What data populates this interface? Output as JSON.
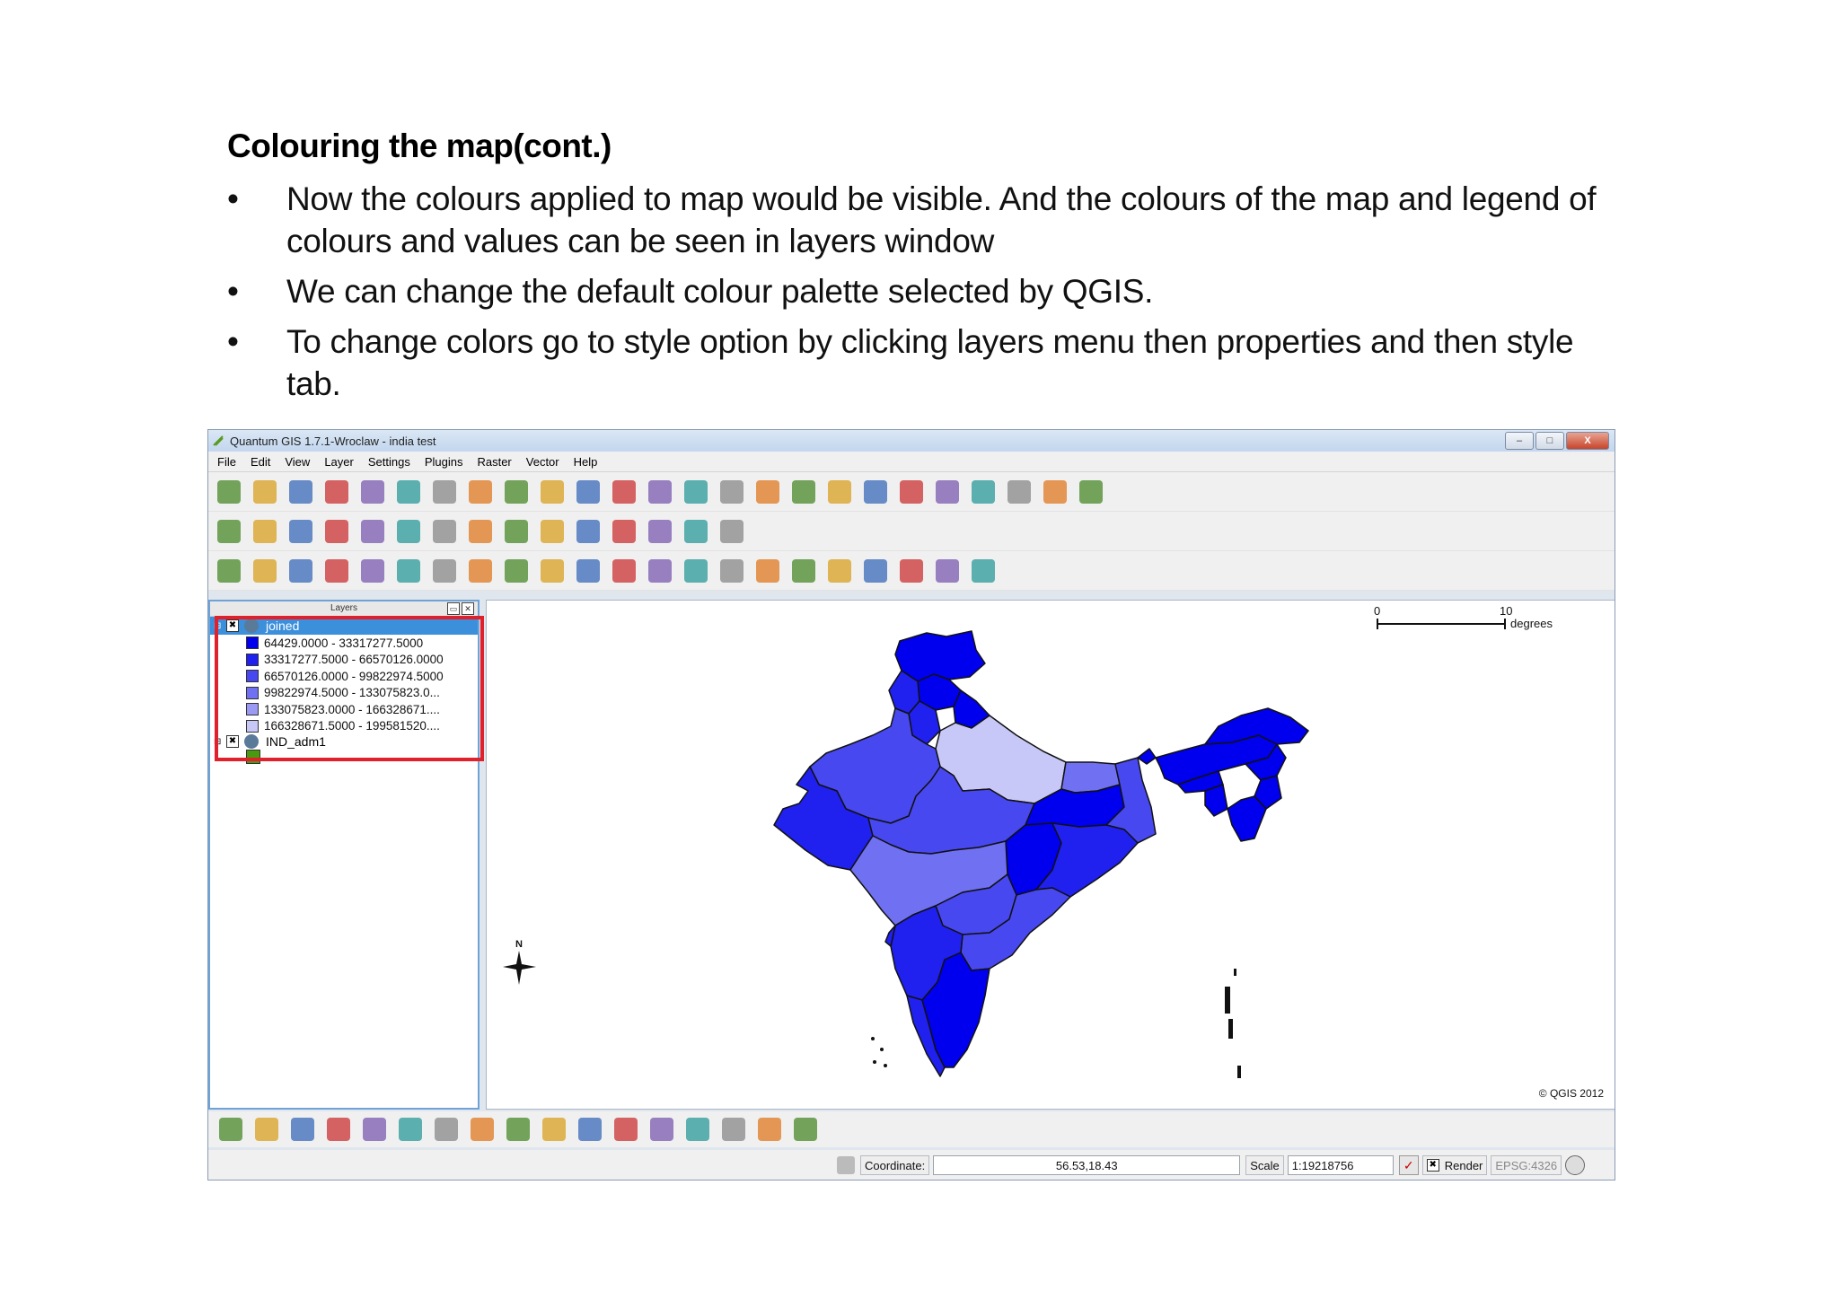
{
  "slide": {
    "title": "Colouring the map(cont.)",
    "bullets": [
      "Now the colours applied to map would be visible. And the colours of the map and legend of colours and values can be seen in layers window",
      "We can change the default colour palette selected by QGIS.",
      "To change colors go to style option by clicking layers menu then properties and then style tab."
    ],
    "bullet_symbol": "•"
  },
  "window": {
    "title": "Quantum GIS 1.7.1-Wroclaw - india test",
    "buttons": [
      "–",
      "□",
      "X"
    ]
  },
  "menu": [
    "File",
    "Edit",
    "View",
    "Layer",
    "Settings",
    "Plugins",
    "Raster",
    "Vector",
    "Help"
  ],
  "layers_panel": {
    "header": "Layers",
    "layers": [
      {
        "name": "joined",
        "checked": "✖",
        "legend": [
          {
            "label": "64429.0000 - 33317277.5000",
            "color": "#0000ee"
          },
          {
            "label": "33317277.5000 - 66570126.0000",
            "color": "#2020ef"
          },
          {
            "label": "66570126.0000 - 99822974.5000",
            "color": "#4848f0"
          },
          {
            "label": "99822974.5000 - 133075823.0...",
            "color": "#7070f2"
          },
          {
            "label": "133075823.0000 - 166328671....",
            "color": "#9a9af5"
          },
          {
            "label": "166328671.5000 - 199581520....",
            "color": "#c8c8f8"
          }
        ]
      },
      {
        "name": "IND_adm1",
        "checked": "✖",
        "legend": [
          {
            "label": "",
            "color": "#4a9a10"
          }
        ]
      }
    ]
  },
  "map": {
    "scale_start": "0",
    "scale_end": "10",
    "scale_unit": "degrees",
    "north_label": "N",
    "copyright": "© QGIS 2012"
  },
  "statusbar": {
    "coordinate_label": "Coordinate:",
    "coordinate_value": "56.53,18.43",
    "scale_label": "Scale",
    "scale_value": "1:19218756",
    "render_label": "Render",
    "render_checked": "✖",
    "crs": "EPSG:4326"
  },
  "toolbar_icons": {
    "row1": [
      "new-project",
      "open-project",
      "save-project",
      "save-as",
      "print-composer",
      "print",
      "add-vector",
      "add-raster",
      "add-postgis",
      "add-spatialite",
      "add-wms",
      "new-shapefile",
      "remove-layer",
      "add-wfs",
      "add-mssql",
      "toggle-edit",
      "save-edits",
      "add-feature",
      "move-feature",
      "delete-node",
      "cut-features",
      "copy-features",
      "paste-features",
      "help",
      "whats-this"
    ],
    "row2": [
      "pan",
      "zoom-in",
      "zoom-out",
      "zoom-full",
      "zoom-layer",
      "zoom-selection",
      "zoom-last",
      "zoom-next",
      "refresh",
      "identify",
      "select",
      "measure",
      "map-tips",
      "bookmarks",
      "annotation"
    ],
    "row3": [
      "undo",
      "redo",
      "simplify",
      "add-ring",
      "add-part",
      "fill-ring",
      "delete-ring",
      "delete-part",
      "reshape",
      "split",
      "merge",
      "rotate-point",
      "label",
      "pin",
      "highlight",
      "identify-arrow",
      "attribute-table",
      "measure-line",
      "text-annotation",
      "home",
      "capture",
      "text-tool"
    ],
    "plugins": [
      "copyright",
      "grass",
      "dxf",
      "georeferencer",
      "coordinate-capture",
      "raster-calc",
      "globe",
      "histogram",
      "north-arrow",
      "gps",
      "edit-tool",
      "leaf",
      "line-tool",
      "spit",
      "vehicle",
      "table",
      "image"
    ]
  },
  "colors": {
    "selection": "#3b8fdb",
    "highlight_box": "#e0202a",
    "map_fill_dark": "#0000ee"
  }
}
